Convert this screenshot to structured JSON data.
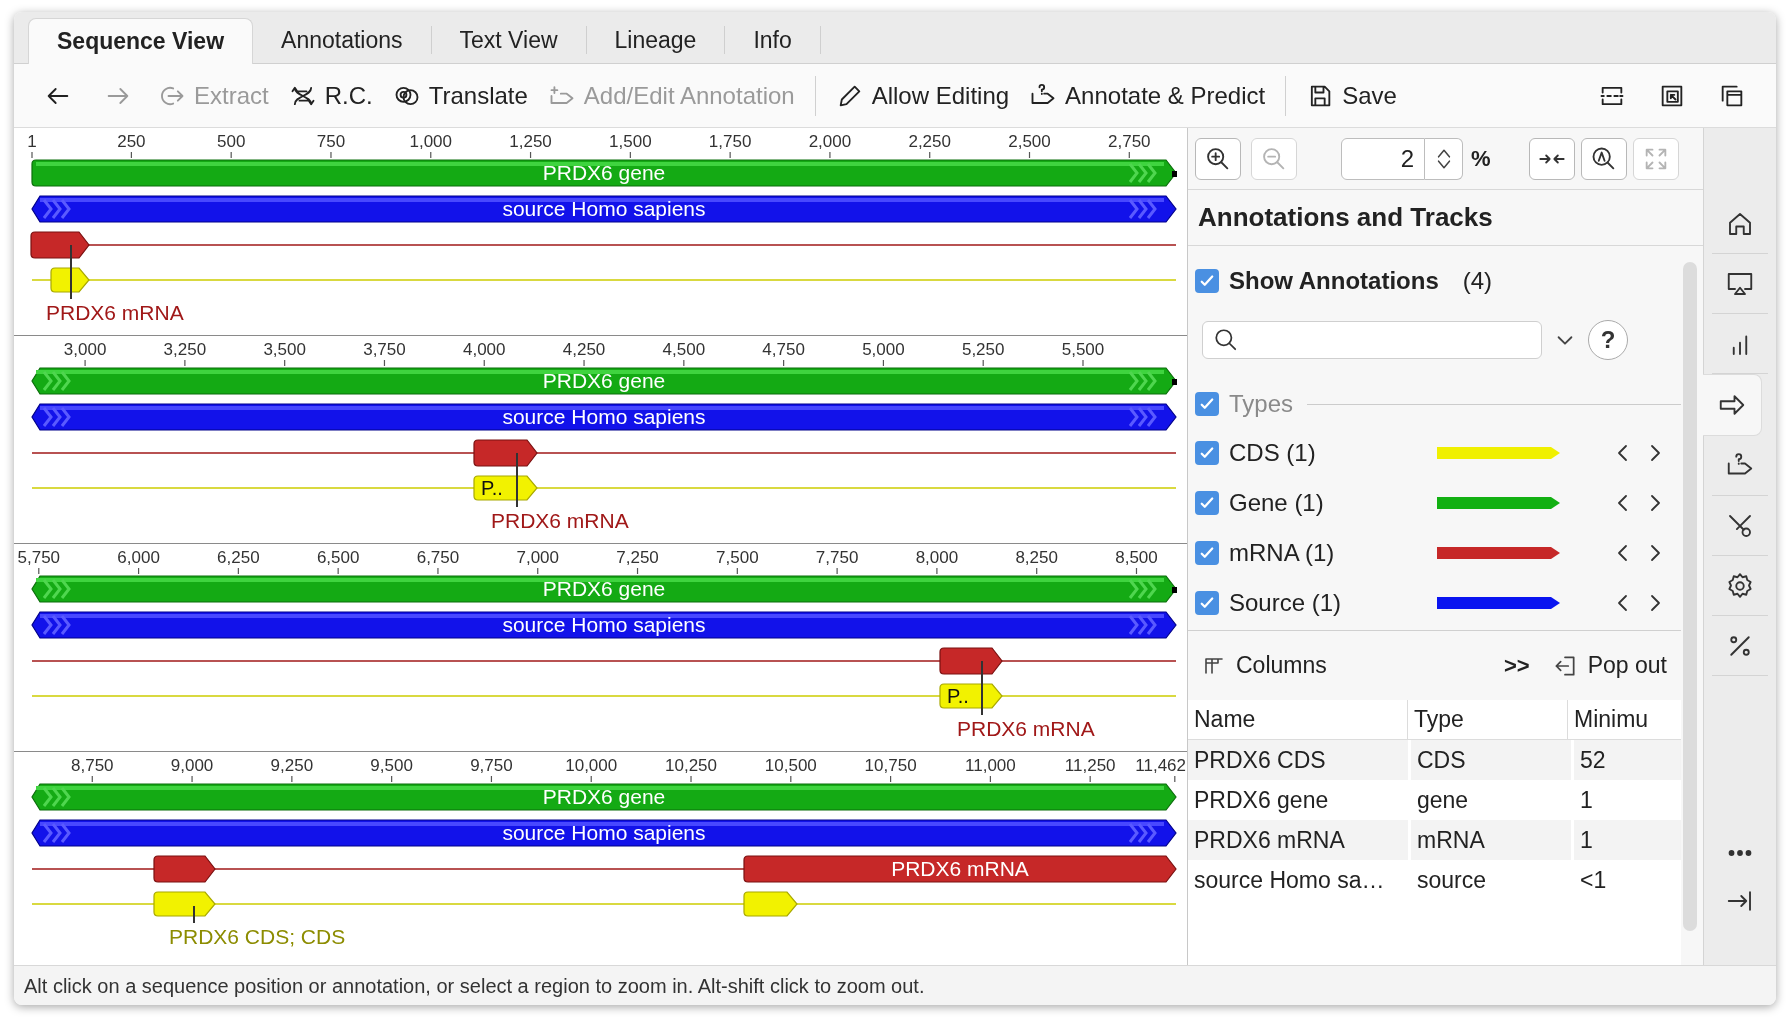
{
  "tabs": [
    {
      "label": "Sequence View",
      "selected": true
    },
    {
      "label": "Annotations",
      "selected": false
    },
    {
      "label": "Text View",
      "selected": false
    },
    {
      "label": "Lineage",
      "selected": false
    },
    {
      "label": "Info",
      "selected": false
    }
  ],
  "toolbar": [
    {
      "kind": "back",
      "disabled": false
    },
    {
      "kind": "forward",
      "disabled": true
    },
    {
      "kind": "extract",
      "label": "Extract",
      "disabled": true
    },
    {
      "kind": "rc",
      "label": "R.C.",
      "disabled": false
    },
    {
      "kind": "translate",
      "label": "Translate",
      "disabled": false
    },
    {
      "kind": "add_annotation",
      "label": "Add/Edit Annotation",
      "disabled": true
    },
    {
      "kind": "separator"
    },
    {
      "kind": "edit",
      "label": "Allow Editing",
      "disabled": false
    },
    {
      "kind": "predict",
      "label": "Annotate & Predict",
      "disabled": false
    },
    {
      "kind": "separator"
    },
    {
      "kind": "save",
      "label": "Save",
      "disabled": false
    },
    {
      "kind": "split",
      "disabled": false
    },
    {
      "kind": "restore_window",
      "disabled": false
    },
    {
      "kind": "windows",
      "disabled": false
    }
  ],
  "sequence_view": {
    "rows": [
      {
        "ticks": [
          "1",
          "250",
          "500",
          "750",
          "1,000",
          "1,250",
          "1,500",
          "1,750",
          "2,000",
          "2,250",
          "2,500",
          "2,750"
        ],
        "gene_label": "PRDX6 gene",
        "source_label": "source Homo sapiens",
        "callout": {
          "kind": "mrna",
          "text": "PRDX6 mRNA"
        }
      },
      {
        "ticks": [
          "3,000",
          "3,250",
          "3,500",
          "3,750",
          "4,000",
          "4,250",
          "4,500",
          "4,750",
          "5,000",
          "5,250",
          "5,500"
        ],
        "gene_label": "PRDX6 gene",
        "source_label": "source Homo sapiens",
        "cds_block_text": "P..",
        "callout": {
          "kind": "mrna",
          "text": "PRDX6 mRNA"
        }
      },
      {
        "ticks": [
          "5,750",
          "6,000",
          "6,250",
          "6,500",
          "6,750",
          "7,000",
          "7,250",
          "7,500",
          "7,750",
          "8,000",
          "8,250",
          "8,500"
        ],
        "gene_label": "PRDX6 gene",
        "source_label": "source Homo sapiens",
        "cds_block_text": "P..",
        "callout": {
          "kind": "mrna",
          "text": "PRDX6 mRNA"
        }
      },
      {
        "ticks": [
          "8,750",
          "9,000",
          "9,250",
          "9,500",
          "9,750",
          "10,000",
          "10,250",
          "10,500",
          "10,750",
          "11,000",
          "11,250",
          "11,462"
        ],
        "gene_label": "PRDX6 gene",
        "source_label": "source Homo sapiens",
        "mrna_block_text": "PRDX6 mRNA",
        "callout": {
          "kind": "cds",
          "text": "PRDX6 CDS; CDS"
        }
      }
    ]
  },
  "zoom": [
    {
      "kind": "zoom_in",
      "disabled": false
    },
    {
      "kind": "zoom_out",
      "disabled": true
    },
    {
      "kind": "value",
      "value": "2"
    },
    {
      "kind": "spinner"
    },
    {
      "kind": "unit",
      "text": "%"
    },
    {
      "kind": "collapse",
      "disabled": false
    },
    {
      "kind": "zoom_selection",
      "disabled": false
    },
    {
      "kind": "fit",
      "disabled": true
    }
  ],
  "annotations_panel": {
    "title": "Annotations and Tracks",
    "show_annotations": {
      "label": "Show Annotations",
      "count": "(4)",
      "checked": true
    },
    "help_button": "?",
    "types": {
      "label": "Types",
      "checked": true,
      "items": [
        {
          "label": "CDS (1)",
          "checked": true,
          "color": "#f0f000"
        },
        {
          "label": "Gene (1)",
          "checked": true,
          "color": "#12b012"
        },
        {
          "label": "mRNA (1)",
          "checked": true,
          "color": "#c62828"
        },
        {
          "label": "Source (1)",
          "checked": true,
          "color": "#0a14f0"
        }
      ]
    },
    "columns_button": "Columns",
    "more_button": ">>",
    "pop_out_button": "Pop out",
    "table": {
      "columns": [
        "Name",
        "Type",
        "Minimu"
      ],
      "rows": [
        [
          "PRDX6 CDS",
          "CDS",
          "52"
        ],
        [
          "PRDX6 gene",
          "gene",
          "1"
        ],
        [
          "PRDX6 mRNA",
          "mRNA",
          "1"
        ],
        [
          "source Homo sa…",
          "source",
          "<1"
        ]
      ]
    }
  },
  "side_icons": [
    {
      "kind": "home",
      "selected": false
    },
    {
      "kind": "display",
      "selected": false
    },
    {
      "kind": "stats",
      "selected": false
    },
    {
      "kind": "annotations",
      "selected": true
    },
    {
      "kind": "predict",
      "selected": false
    },
    {
      "kind": "cut",
      "selected": false
    },
    {
      "kind": "settings",
      "selected": false
    },
    {
      "kind": "percent",
      "selected": false
    },
    {
      "kind": "more",
      "selected": false
    },
    {
      "kind": "collapse",
      "selected": false
    }
  ],
  "status_bar": "Alt click on a sequence position or annotation, or select a region to zoom in. Alt-shift click to zoom out."
}
